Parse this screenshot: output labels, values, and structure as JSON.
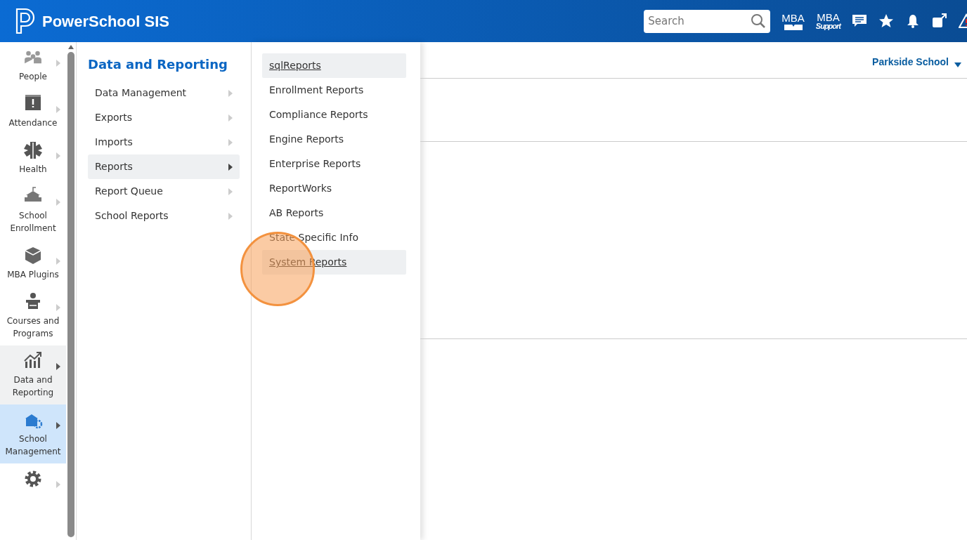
{
  "header": {
    "brand": "PowerSchool SIS",
    "search": {
      "placeholder": "Search"
    },
    "tools": [
      {
        "kind": "mba-download",
        "label": "MBA"
      },
      {
        "kind": "mba-support",
        "label": "MBA",
        "sublabel": "Support"
      },
      {
        "kind": "chat"
      },
      {
        "kind": "star"
      },
      {
        "kind": "bell"
      },
      {
        "kind": "external"
      },
      {
        "kind": "warning"
      }
    ]
  },
  "sidebar": {
    "items": [
      {
        "kind": "people",
        "label": "People",
        "selected": false,
        "expanded": false
      },
      {
        "kind": "attendance",
        "label": "Attendance",
        "selected": false,
        "expanded": false
      },
      {
        "kind": "health",
        "label": "Health",
        "selected": false,
        "expanded": false
      },
      {
        "kind": "enrollment",
        "label": "School Enrollment",
        "selected": false,
        "expanded": false
      },
      {
        "kind": "plugins",
        "label": "MBA Plugins",
        "selected": false,
        "expanded": false
      },
      {
        "kind": "courses",
        "label": "Courses and Programs",
        "selected": false,
        "expanded": false
      },
      {
        "kind": "reporting",
        "label": "Data and Reporting",
        "selected": false,
        "expanded": true
      },
      {
        "kind": "management",
        "label": "School Management",
        "selected": true,
        "expanded": false
      },
      {
        "kind": "settings",
        "selected": false,
        "expanded": false
      }
    ]
  },
  "menu": {
    "title": "Data and Reporting",
    "items": [
      {
        "label": "Data Management",
        "selected": false
      },
      {
        "label": "Exports",
        "selected": false
      },
      {
        "label": "Imports",
        "selected": false
      },
      {
        "label": "Reports",
        "selected": true
      },
      {
        "label": "Report Queue",
        "selected": false
      },
      {
        "label": "School Reports",
        "selected": false
      }
    ]
  },
  "submenu": {
    "items": [
      {
        "label": "sqlReports",
        "highlighted": true,
        "clicked": false
      },
      {
        "label": "Enrollment Reports",
        "highlighted": false,
        "clicked": false
      },
      {
        "label": "Compliance Reports",
        "highlighted": false,
        "clicked": false
      },
      {
        "label": "Engine Reports",
        "highlighted": false,
        "clicked": false
      },
      {
        "label": "Enterprise Reports",
        "highlighted": false,
        "clicked": false
      },
      {
        "label": "ReportWorks",
        "highlighted": false,
        "clicked": false
      },
      {
        "label": "AB Reports",
        "highlighted": false,
        "clicked": false
      },
      {
        "label": "State Specific Info",
        "highlighted": false,
        "clicked": false
      },
      {
        "label": "System Reports",
        "highlighted": true,
        "clicked": true
      }
    ]
  },
  "school_selector": {
    "label": "Parkside School"
  }
}
